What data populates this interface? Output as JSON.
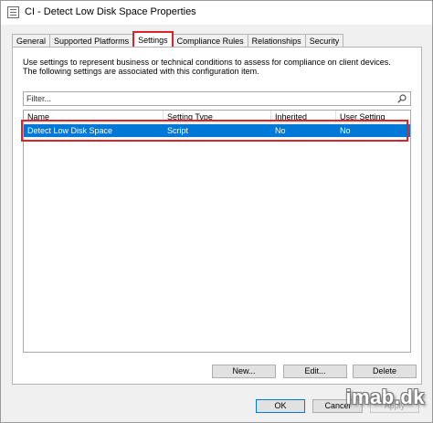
{
  "window": {
    "title": "CI - Detect Low Disk Space Properties"
  },
  "tabs": [
    {
      "label": "General"
    },
    {
      "label": "Supported Platforms"
    },
    {
      "label": "Settings"
    },
    {
      "label": "Compliance Rules"
    },
    {
      "label": "Relationships"
    },
    {
      "label": "Security"
    }
  ],
  "active_tab": "Settings",
  "settings": {
    "description": "Use settings to represent business or technical conditions to assess for compliance on client devices. The following settings are associated with this configuration item.",
    "filter_placeholder": "Filter...",
    "columns": [
      "Name",
      "Setting Type",
      "Inherited",
      "User Setting"
    ],
    "rows": [
      {
        "name": "Detect Low Disk Space",
        "type": "Script",
        "inherited": "No",
        "user_setting": "No",
        "selected": true
      }
    ],
    "buttons": {
      "new": "New...",
      "edit": "Edit...",
      "delete": "Delete"
    }
  },
  "dialog_buttons": {
    "ok": "OK",
    "cancel": "Cancel",
    "apply": "Apply"
  },
  "watermark": "imab.dk",
  "colors": {
    "selection": "#0078d7",
    "annotation": "#d9252a"
  }
}
